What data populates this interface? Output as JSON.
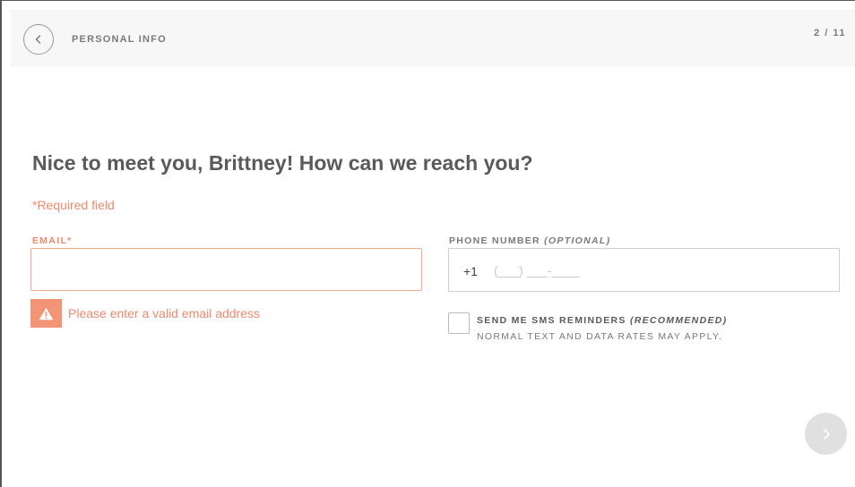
{
  "header": {
    "back_icon": "chevron-left-icon",
    "title": "PERSONAL INFO",
    "step": "2 / 11"
  },
  "main": {
    "heading": "Nice to meet you, Brittney! How can we reach you?",
    "required_note": "*Required field",
    "email": {
      "label": "EMAIL*",
      "value": "",
      "error": "Please enter a valid email address",
      "error_icon": "warning-triangle-icon"
    },
    "phone": {
      "label": "PHONE NUMBER",
      "label_suffix": "(OPTIONAL)",
      "prefix": "+1",
      "placeholder": "(___) ___-____"
    },
    "sms": {
      "label": "SEND ME SMS REMINDERS",
      "label_suffix": "(RECOMMENDED)",
      "note": "NORMAL TEXT AND DATA RATES MAY APPLY.",
      "checked": false
    },
    "next_icon": "chevron-right-icon"
  },
  "colors": {
    "error": "#f08a6e",
    "error_border": "#f4a98f",
    "header_bg": "#f7f7f7",
    "next_button_bg": "#e0e0e0"
  }
}
